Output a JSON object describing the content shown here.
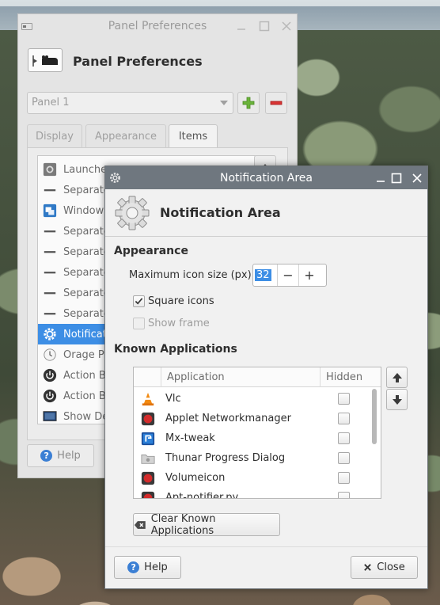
{
  "panel_prefs": {
    "title": "Panel Preferences",
    "header_title": "Panel Preferences",
    "panel_select": "Panel 1",
    "tabs": [
      "Display",
      "Appearance",
      "Items"
    ],
    "active_tab": "Items",
    "items": [
      {
        "label": "Launcher",
        "icon": "launcher-icon"
      },
      {
        "label": "Separato",
        "icon": "separator-icon"
      },
      {
        "label": "Window",
        "icon": "window-buttons-icon"
      },
      {
        "label": "Separato",
        "icon": "separator-icon"
      },
      {
        "label": "Separato",
        "icon": "separator-icon"
      },
      {
        "label": "Separato",
        "icon": "separator-icon"
      },
      {
        "label": "Separato",
        "icon": "separator-icon"
      },
      {
        "label": "Separato",
        "icon": "separator-icon"
      },
      {
        "label": "Notificat",
        "icon": "gear-icon",
        "selected": true
      },
      {
        "label": "Orage P",
        "icon": "clock-icon"
      },
      {
        "label": "Action B",
        "icon": "power-icon"
      },
      {
        "label": "Action B",
        "icon": "power-icon"
      },
      {
        "label": "Show De",
        "icon": "show-desktop-icon"
      }
    ],
    "help_label": "Help"
  },
  "notif": {
    "title": "Notification Area",
    "header_title": "Notification Area",
    "appearance_heading": "Appearance",
    "max_icon_size_label": "Maximum icon size (px):",
    "max_icon_size_value": "32",
    "minus_label": "−",
    "plus_label": "+",
    "square_icons_label": "Square icons",
    "square_icons_checked": true,
    "show_frame_label": "Show frame",
    "show_frame_checked": false,
    "known_apps_heading": "Known Applications",
    "col_application": "Application",
    "col_hidden": "Hidden",
    "apps": [
      {
        "name": "Vlc",
        "icon": "vlc-cone-icon",
        "hidden": false
      },
      {
        "name": "Applet Networkmanager",
        "icon": "red-record-icon",
        "hidden": false
      },
      {
        "name": "Mx-tweak",
        "icon": "mx-tweak-icon",
        "hidden": false
      },
      {
        "name": "Thunar Progress Dialog",
        "icon": "folder-icon",
        "hidden": false
      },
      {
        "name": "Volumeicon",
        "icon": "red-record-icon",
        "hidden": false
      },
      {
        "name": "Apt-notifier.py",
        "icon": "red-record-icon",
        "hidden": false
      }
    ],
    "clear_label": "Clear Known Applications",
    "help_label": "Help",
    "close_label": "Close"
  },
  "colors": {
    "selection": "#3d8ee5",
    "notif_titlebar": "#6f777f"
  }
}
